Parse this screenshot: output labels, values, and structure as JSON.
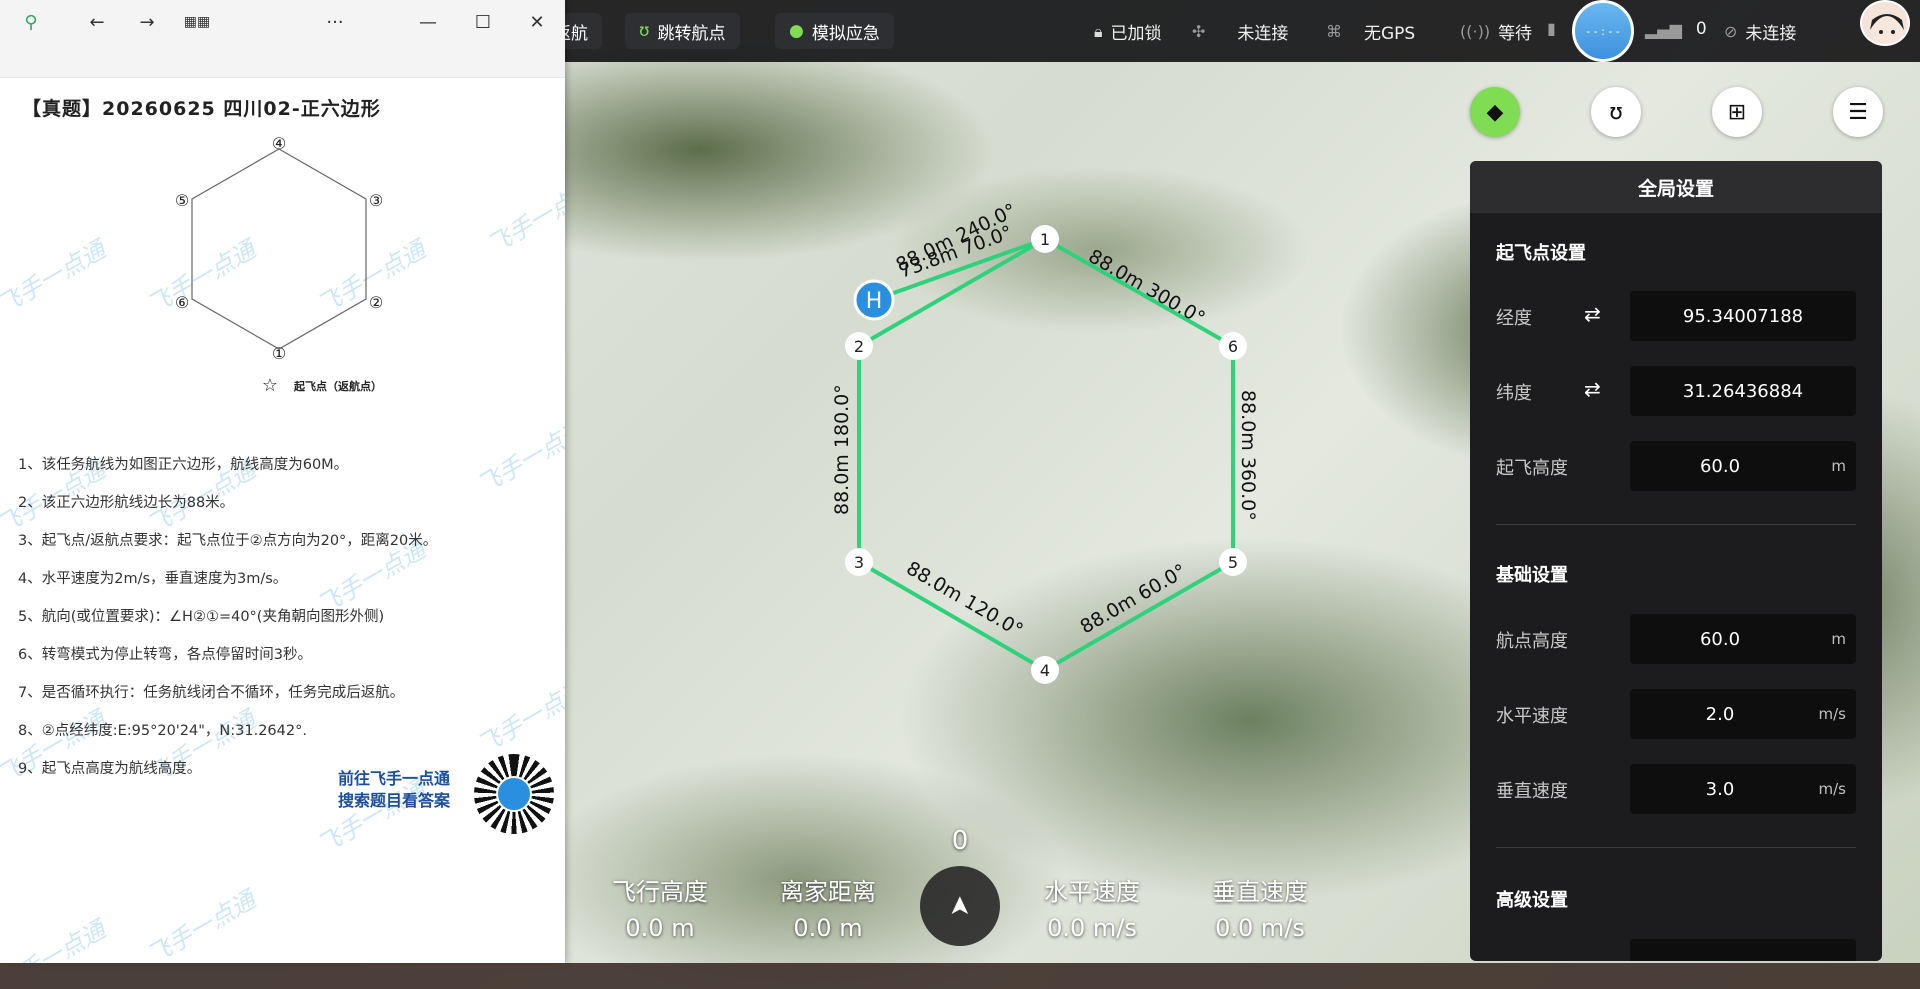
{
  "topbar": {
    "btn_return": "返航",
    "btn_jump": "跳转航点",
    "btn_sim": "模拟应急",
    "lock_status": "已加锁",
    "drone_status": "未连接",
    "gps_status": "无GPS",
    "signal_status": "等待",
    "attitude_label": "- - : - -",
    "count": "0",
    "link_status": "未连接"
  },
  "doc": {
    "title": "【真题】20260625 四川02-正六边形",
    "diagram_nodes": [
      "①",
      "②",
      "③",
      "④",
      "⑤",
      "⑥"
    ],
    "takeoff_legend": "起飞点（返航点）",
    "lines": [
      "1、该任务航线为如图正六边形，航线高度为60M。",
      "2、该正六边形航线边长为88米。",
      "3、起飞点/返航点要求：起飞点位于②点方向为20°，距离20米。",
      "4、水平速度为2m/s，垂直速度为3m/s。",
      "5、航向(或位置要求)：∠H②①=40°(夹角朝向图形外侧)",
      "6、转弯模式为停止转弯，各点停留时间3秒。",
      "7、是否循环执行：任务航线闭合不循环，任务完成后返航。",
      "8、②点经纬度:E:95°20'24\"，N:31.2642°.",
      "9、起飞点高度为航线高度。"
    ],
    "watermark": "飞手一点通",
    "qr_line1": "前往飞手一点通",
    "qr_line2": "搜索题目看答案"
  },
  "map": {
    "home_label": "H",
    "waypoints": [
      "1",
      "2",
      "3",
      "4",
      "5",
      "6"
    ],
    "edge_labels": {
      "e12": "88.0m 240.0°",
      "h1": "73.8m 70.0°",
      "e16": "88.0m 300.0°",
      "e65": "88.0m 360.0°",
      "e54": "88.0m 60.0°",
      "e43": "88.0m 120.0°",
      "e32": "88.0m 180.0°"
    }
  },
  "panel": {
    "title": "全局设置",
    "takeoff_section": "起飞点设置",
    "lon_label": "经度",
    "lon_value": "95.34007188",
    "lat_label": "纬度",
    "lat_value": "31.26436884",
    "takeoff_alt_label": "起飞高度",
    "takeoff_alt_value": "60.0",
    "unit_m": "m",
    "basic_section": "基础设置",
    "wp_alt_label": "航点高度",
    "wp_alt_value": "60.0",
    "hspeed_label": "水平速度",
    "hspeed_value": "2.0",
    "vspeed_label": "垂直速度",
    "vspeed_value": "3.0",
    "unit_ms": "m/s",
    "advanced_section": "高级设置"
  },
  "telemetry": {
    "heading": "0",
    "alt_label": "飞行高度",
    "alt_value": "0.0 m",
    "dist_label": "离家距离",
    "dist_value": "0.0 m",
    "hs_label": "水平速度",
    "hs_value": "0.0 m/s",
    "vs_label": "垂直速度",
    "vs_value": "0.0 m/s"
  },
  "colors": {
    "route": "#2fd17a",
    "accent": "#7fdc53",
    "home": "#2b8fe0"
  }
}
